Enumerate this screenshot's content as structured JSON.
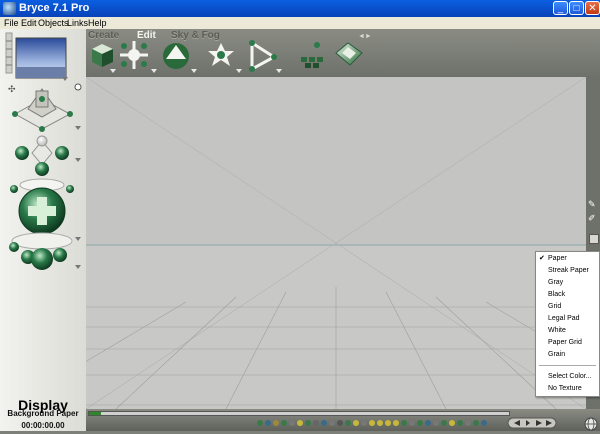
{
  "window": {
    "title": "Bryce 7.1 Pro",
    "min": "_",
    "max": "□",
    "close": "✕"
  },
  "menu": [
    "File",
    "Edit",
    "Objects",
    "Links",
    "Help"
  ],
  "tabs": [
    "Create",
    "Edit",
    "Sky & Fog"
  ],
  "toolbar_tools": [
    "cube-tool-icon",
    "burst-tool-icon",
    "sphere-tool-icon",
    "starburst-tool-icon",
    "triangle-tool-icon",
    "terrain-cluster-icon",
    "stone-tool-icon"
  ],
  "display": {
    "title": "Display",
    "mode": "Background Paper",
    "time": "00:00:00.00"
  },
  "background_menu": {
    "items": [
      "Paper",
      "Streak Paper",
      "Gray",
      "Black",
      "Grid",
      "Legal Pad",
      "White",
      "Paper Grid",
      "Grain"
    ],
    "checked": "Paper",
    "extra": [
      "Select Color...",
      "No Texture"
    ]
  },
  "colors": {
    "titlebar": "#0a5fe0",
    "viewport": "#c6c6c6",
    "panel": "#7d8078",
    "accent_green": "#2a7a4a"
  }
}
